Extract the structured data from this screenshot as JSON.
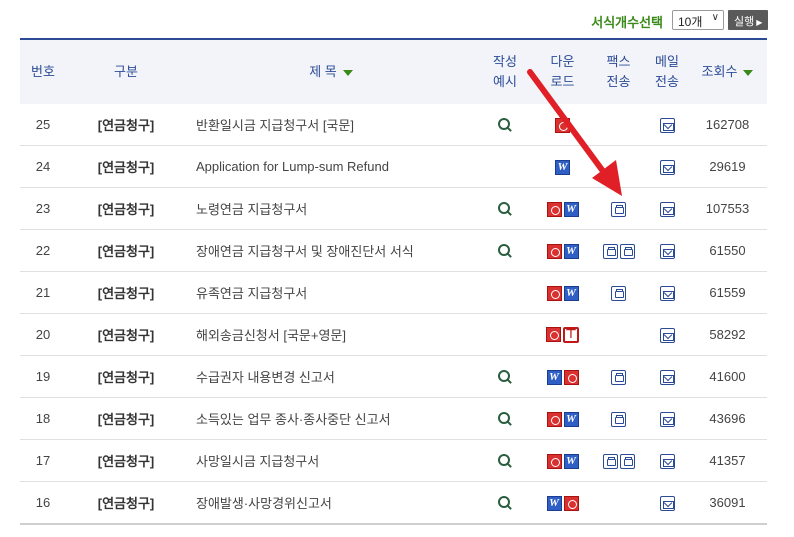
{
  "toolbar": {
    "label": "서식개수선택",
    "select_value": "10개",
    "run_label": "실행"
  },
  "headers": {
    "num": "번호",
    "category": "구분",
    "title": "제  목",
    "example": [
      "작성",
      "예시"
    ],
    "download": [
      "다운",
      "로드"
    ],
    "fax": [
      "팩스",
      "전송"
    ],
    "mail": [
      "메일",
      "전송"
    ],
    "views": "조회수"
  },
  "rows": [
    {
      "num": "25",
      "category": "[연금청구]",
      "title": "반환일시금 지급청구서 [국문]",
      "example": true,
      "download": [
        "hwp"
      ],
      "fax": 0,
      "mail": true,
      "views": "162708"
    },
    {
      "num": "24",
      "category": "[연금청구]",
      "title": "Application for Lump-sum Refund",
      "example": false,
      "download": [
        "word"
      ],
      "fax": 0,
      "mail": true,
      "views": "29619"
    },
    {
      "num": "23",
      "category": "[연금청구]",
      "title": "노령연금 지급청구서",
      "example": true,
      "download": [
        "hwp",
        "word"
      ],
      "fax": 1,
      "mail": true,
      "views": "107553"
    },
    {
      "num": "22",
      "category": "[연금청구]",
      "title": "장애연금 지급청구서 및 장애진단서 서식",
      "example": true,
      "download": [
        "hwp",
        "word"
      ],
      "fax": 2,
      "mail": true,
      "views": "61550"
    },
    {
      "num": "21",
      "category": "[연금청구]",
      "title": "유족연금 지급청구서",
      "example": false,
      "download": [
        "hwp",
        "word"
      ],
      "fax": 1,
      "mail": true,
      "views": "61559"
    },
    {
      "num": "20",
      "category": "[연금청구]",
      "title": "해외송금신청서 [국문+영문]",
      "example": false,
      "download": [
        "hwp",
        "pdf"
      ],
      "fax": 0,
      "mail": true,
      "views": "58292"
    },
    {
      "num": "19",
      "category": "[연금청구]",
      "title": "수급권자 내용변경 신고서",
      "example": true,
      "download": [
        "word",
        "hwp"
      ],
      "fax": 1,
      "mail": true,
      "views": "41600"
    },
    {
      "num": "18",
      "category": "[연금청구]",
      "title": "소득있는 업무 종사·종사중단 신고서",
      "example": true,
      "download": [
        "hwp",
        "word"
      ],
      "fax": 1,
      "mail": true,
      "views": "43696"
    },
    {
      "num": "17",
      "category": "[연금청구]",
      "title": "사망일시금 지급청구서",
      "example": true,
      "download": [
        "hwp",
        "word"
      ],
      "fax": 2,
      "mail": true,
      "views": "41357"
    },
    {
      "num": "16",
      "category": "[연금청구]",
      "title": "장애발생·사망경위신고서",
      "example": true,
      "download": [
        "word",
        "hwp"
      ],
      "fax": 0,
      "mail": true,
      "views": "36091"
    }
  ],
  "colors": {
    "accent": "#2b4b96",
    "green": "#3a8a1a",
    "arrow": "#e01f26"
  },
  "icons": {
    "hwp": "hwp-file-icon",
    "word": "word-file-icon",
    "pdf": "pdf-file-icon",
    "fax": "fax-icon",
    "mail": "mail-icon",
    "zoom": "zoom-icon"
  }
}
